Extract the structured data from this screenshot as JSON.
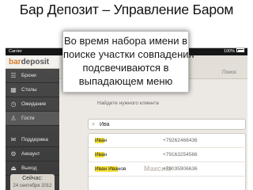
{
  "slide": {
    "title": "Бар Депозит – Управление Баром",
    "callout_lines": [
      "Во время набора имени в",
      "поиске участки совпадения",
      "подсвечиваются в",
      "выпадающем меню"
    ]
  },
  "status_bar": {
    "carrier": "Carrier",
    "battery": "100%"
  },
  "app": {
    "logo_part1": "bar",
    "logo_part2": "deposit",
    "nav": [
      {
        "label": "Брони",
        "icon": "bookings-icon",
        "active": false
      },
      {
        "label": "Столы",
        "icon": "tables-icon",
        "active": false
      },
      {
        "label": "Ожидание",
        "icon": "waiting-icon",
        "active": false
      },
      {
        "label": "Гости",
        "icon": "guests-icon",
        "active": true
      },
      {
        "label": "Поддержка",
        "icon": "support-icon",
        "active": false
      },
      {
        "label": "Аккаунт",
        "icon": "account-icon",
        "active": false
      },
      {
        "label": "Выход",
        "icon": "logout-icon",
        "active": false
      }
    ],
    "clock_label": "Сейчас:",
    "clock_date": "24 сентября 2012"
  },
  "search": {
    "panel_label": "Поиск",
    "prompt": "Найдите нужного клиента",
    "query": "Ива",
    "watermark": "Максим",
    "results": [
      {
        "match": "Ива",
        "rest": "н",
        "phone": "+79262468436"
      },
      {
        "match": "Ива",
        "rest": "н",
        "phone": "+79163254566"
      },
      {
        "match": "Иван Ива",
        "rest": "нов",
        "phone": "+79035906636"
      }
    ]
  },
  "colors": {
    "highlight": "#f4de34",
    "brand": "#d57b2b",
    "sidebar": "#454545"
  }
}
